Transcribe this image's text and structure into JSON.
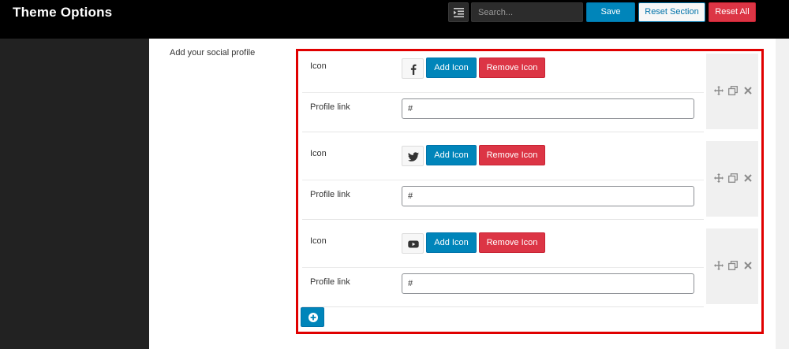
{
  "header": {
    "title": "Theme Options",
    "search_placeholder": "Search...",
    "save_label": "Save",
    "reset_section_label": "Reset Section",
    "reset_all_label": "Reset All",
    "list_toggle_icon": "list-outdent-icon"
  },
  "field": {
    "label": "Add your social profile",
    "items": [
      {
        "icon_label": "Icon",
        "icon_name": "facebook-icon",
        "add_icon_label": "Add Icon",
        "remove_icon_label": "Remove Icon",
        "link_label": "Profile link",
        "link_value": "#"
      },
      {
        "icon_label": "Icon",
        "icon_name": "twitter-icon",
        "add_icon_label": "Add Icon",
        "remove_icon_label": "Remove Icon",
        "link_label": "Profile link",
        "link_value": "#"
      },
      {
        "icon_label": "Icon",
        "icon_name": "youtube-icon",
        "add_icon_label": "Add Icon",
        "remove_icon_label": "Remove Icon",
        "link_label": "Profile link",
        "link_value": "#"
      }
    ],
    "add_row_icon": "plus-circle-icon"
  },
  "colors": {
    "primary": "#0085ba",
    "danger": "#dc3545",
    "highlight": "#e00000",
    "topbar": "#000000",
    "sidebar": "#222222"
  }
}
